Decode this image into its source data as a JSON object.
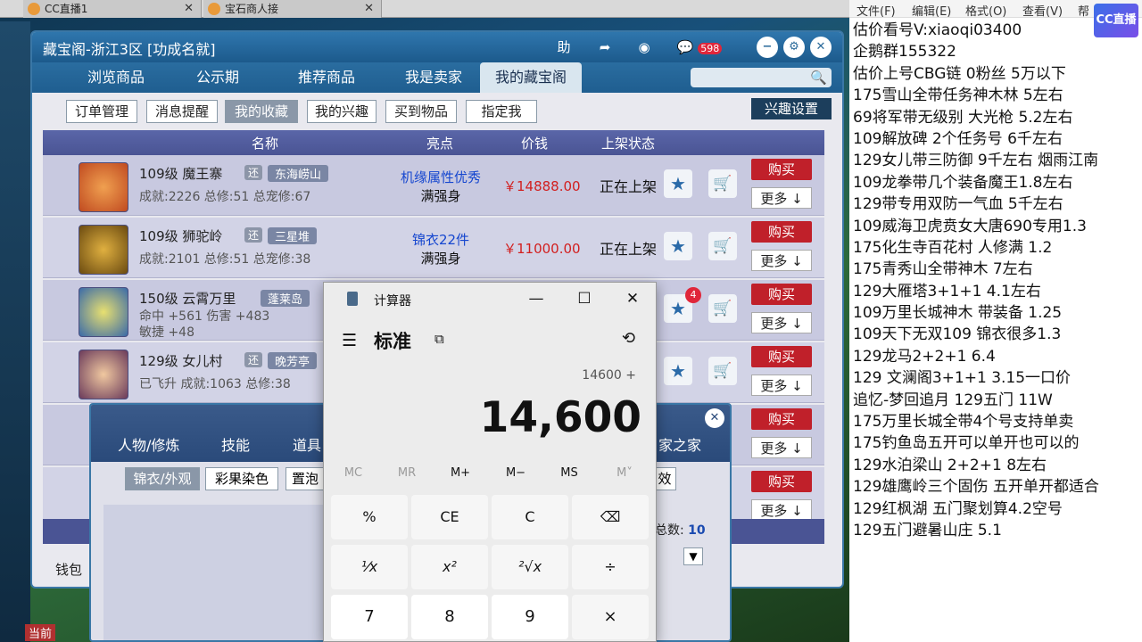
{
  "browser_tabs": [
    {
      "label": "CC直播1"
    },
    {
      "label": "宝石商人接"
    }
  ],
  "panel": {
    "title": "藏宝阁-浙江3区 [功成名就]",
    "help_label": "助",
    "badge_count": "598",
    "main_tabs": [
      "浏览商品",
      "公示期",
      "推荐商品",
      "我是卖家",
      "我的藏宝阁"
    ],
    "active_tab": "我的藏宝阁",
    "sub_tabs": [
      "订单管理",
      "消息提醒",
      "我的收藏",
      "我的兴趣",
      "买到物品",
      "指定我"
    ],
    "active_sub_tab": "我的收藏",
    "interest_settings": "兴趣设置",
    "columns": {
      "name": "名称",
      "highlight": "亮点",
      "price": "价钱",
      "status": "上架状态"
    }
  },
  "rows": [
    {
      "level": "109级",
      "school": "魔王寨",
      "huan": "还",
      "server": "东海崂山",
      "sub": "成就:2226 总修:51 总宠修:67",
      "feat_a": "机缘属性优秀",
      "feat_b": "满强身",
      "price": "￥14888.00",
      "status": "正在上架",
      "buy": "购买",
      "more": "更多 ↓"
    },
    {
      "level": "109级",
      "school": "狮驼岭",
      "huan": "还",
      "server": "三星堆",
      "sub": "成就:2101 总修:51 总宠修:38",
      "feat_a": "锦衣22件",
      "feat_b": "满强身",
      "price": "￥11000.00",
      "status": "正在上架",
      "buy": "购买",
      "more": "更多 ↓"
    },
    {
      "level": "150级",
      "school": "云霄万里",
      "huan": "",
      "server": "蓬莱岛",
      "sub": "命中 +561 伤害 +483",
      "sub2": "敏捷 +48",
      "feat_a": "",
      "feat_b": "",
      "price": "",
      "status": "",
      "buy": "购买",
      "more": "更多 ↓",
      "badge": "4"
    },
    {
      "level": "129级",
      "school": "女儿村",
      "huan": "还",
      "server": "晚芳亭",
      "sub": "已飞升 成就:1063 总修:38",
      "feat_a": "",
      "feat_b": "",
      "price": "",
      "status": "",
      "buy": "购买",
      "more": "更多 ↓"
    }
  ],
  "extra_rows": [
    {
      "buy": "购买",
      "more": "更多 ↓"
    },
    {
      "buy": "购买",
      "more": "更多 ↓"
    }
  ],
  "sub_panel": {
    "tabs": [
      "人物/修炼",
      "技能",
      "道具"
    ],
    "tab_right": "家之家",
    "buttons": [
      "锦衣/外观",
      "彩果染色",
      "置泡"
    ],
    "active_button": "锦衣/外观",
    "effect": "效",
    "total_label": "总数:",
    "total_value": "10",
    "wallet": "钱包"
  },
  "calculator": {
    "title": "计算器",
    "mode": "标准",
    "expression": "14600 +",
    "display": "14,600",
    "memory": [
      "MC",
      "MR",
      "M+",
      "M−",
      "MS",
      "M˅"
    ],
    "keys": [
      [
        "%",
        "CE",
        "C",
        "⌫"
      ],
      [
        "¹⁄x",
        "x²",
        "²√x",
        "÷"
      ],
      [
        "7",
        "8",
        "9",
        "×"
      ]
    ]
  },
  "notepad": {
    "menu": [
      "文件(F)",
      "编辑(E)",
      "格式(O)",
      "查看(V)",
      "帮"
    ],
    "lines": [
      "估价看号V:xiaoqi03400",
      "企鹅群155322",
      "估价上号CBG链  0粉丝 5万以下",
      "175雪山全带任务神木林 5左右",
      "69将军带无级别 大光枪 5.2左右",
      "109解放碑 2个任务号 6千左右",
      "129女儿带三防御 9千左右 烟雨江南",
      "109龙拳带几个装备魔王1.8左右",
      "129带专用双防一气血 5千左右",
      "109威海卫虎贲女大唐690专用1.3",
      "175化生寺百花村 人修满 1.2",
      "175青秀山全带神木  7左右",
      "129大雁塔3+1+1   4.1左右",
      "109万里长城神木 带装备  1.25",
      "109天下无双109  锦衣很多1.3",
      "129龙马2+2+1  6.4",
      "129 文澜阁3+1+1    3.15一口价",
      "追忆-梦回追月 129五门 11W",
      "175万里长城全带4个号支持单卖",
      "175钓鱼岛五开可以单开也可以的",
      "129水泊梁山 2+2+1 8左右",
      "129雄鹰岭三个固伤 五开单开都适合",
      "129红枫湖 五门聚划算4.2空号",
      "129五门避暑山庄  5.1"
    ]
  },
  "cc_logo": "CC直播",
  "game_hud": {
    "current": "当前"
  }
}
